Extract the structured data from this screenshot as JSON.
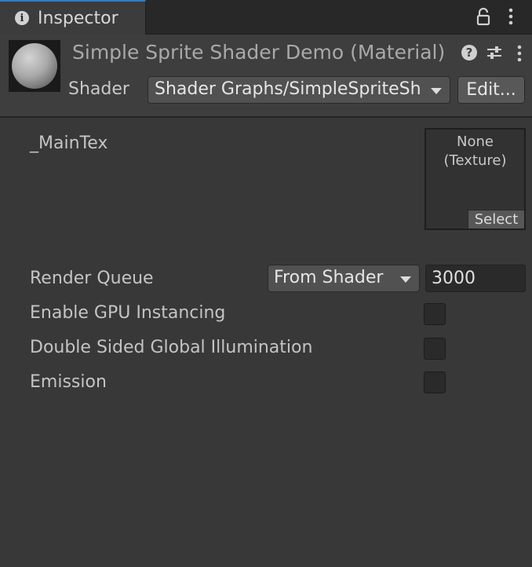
{
  "tab": {
    "title": "Inspector",
    "info_icon_glyph": "i"
  },
  "material": {
    "title": "Simple Sprite Shader Demo (Material)",
    "shader_label": "Shader",
    "shader_value": "Shader Graphs/SimpleSpriteShader",
    "edit_label": "Edit...",
    "help_glyph": "?"
  },
  "properties": {
    "main_tex_label": "_MainTex",
    "texture_none": "None",
    "texture_type": "(Texture)",
    "select_label": "Select",
    "render_queue_label": "Render Queue",
    "render_queue_mode": "From Shader",
    "render_queue_value": "3000",
    "gpu_instancing_label": "Enable GPU Instancing",
    "gpu_instancing_checked": false,
    "double_sided_gi_label": "Double Sided Global Illumination",
    "double_sided_gi_checked": false,
    "emission_label": "Emission",
    "emission_checked": false
  },
  "icons": [
    "info-icon",
    "lock-icon",
    "kebab-menu-icon",
    "help-icon",
    "preset-icon",
    "dropdown-arrow-icon"
  ],
  "colors": {
    "background": "#383838",
    "header": "#3e3e3e",
    "tab_accent": "#3a79bb",
    "text": "#c4c4c4"
  }
}
